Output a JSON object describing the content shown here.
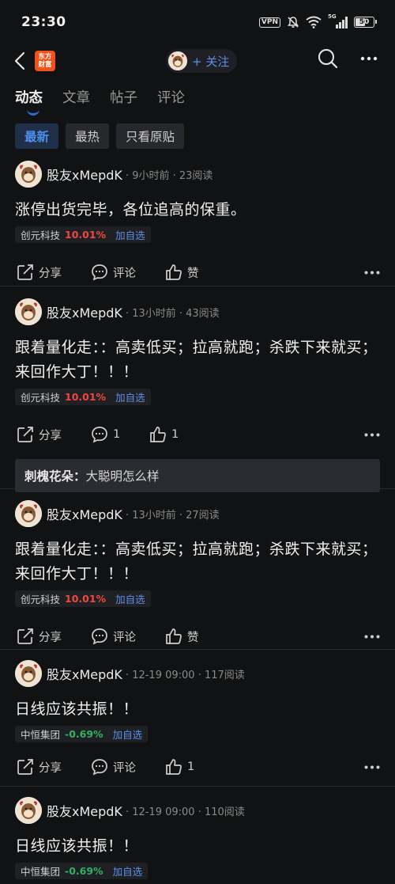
{
  "status": {
    "time": "23:30",
    "vpn": "VPN",
    "network": "5G",
    "battery": "50"
  },
  "header": {
    "logo_line1": "东方",
    "logo_line2": "财富",
    "follow_label": "+ 关注"
  },
  "tabs": [
    {
      "label": "动态",
      "active": true
    },
    {
      "label": "文章",
      "active": false
    },
    {
      "label": "帖子",
      "active": false
    },
    {
      "label": "评论",
      "active": false
    }
  ],
  "filters": [
    {
      "label": "最新",
      "active": true
    },
    {
      "label": "最热",
      "active": false
    },
    {
      "label": "只看原贴",
      "active": false
    }
  ],
  "posts": [
    {
      "user": "股友xMepdK",
      "meta": "· 9小时前 · 23阅读",
      "text": "涨停出货完毕，各位追高的保重。",
      "stock": {
        "name": "创元科技",
        "change": "10.01%",
        "add": "加自选",
        "direction": "up"
      },
      "share": "分享",
      "comment": "评论",
      "like": "赞"
    },
    {
      "user": "股友xMepdK",
      "meta": "· 13小时前 · 43阅读",
      "text": "跟着量化走：：高卖低买；拉高就跑；杀跌下来就买；来回作大丁！！！",
      "stock": {
        "name": "创元科技",
        "change": "10.01%",
        "add": "加自选",
        "direction": "up"
      },
      "share": "分享",
      "comment": "1",
      "like": "1",
      "reply": {
        "user": "刺槐花朵：",
        "text": "大聪明怎么样"
      }
    },
    {
      "user": "股友xMepdK",
      "meta": "· 13小时前 · 27阅读",
      "text": "跟着量化走：：高卖低买；拉高就跑；杀跌下来就买；来回作大丁！！！",
      "stock": {
        "name": "创元科技",
        "change": "10.01%",
        "add": "加自选",
        "direction": "up"
      },
      "share": "分享",
      "comment": "评论",
      "like": "赞"
    },
    {
      "user": "股友xMepdK",
      "meta": "· 12-19 09:00 · 117阅读",
      "text": "日线应该共振！！",
      "stock": {
        "name": "中恒集团",
        "change": "-0.69%",
        "add": "加自选",
        "direction": "down"
      },
      "share": "分享",
      "comment": "评论",
      "like": "1"
    },
    {
      "user": "股友xMepdK",
      "meta": "· 12-19 09:00 · 110阅读",
      "text": "日线应该共振！！",
      "stock": {
        "name": "中恒集团",
        "change": "-0.69%",
        "add": "加自选",
        "direction": "down"
      }
    }
  ],
  "colors": {
    "background": "#111213",
    "accent_blue": "#4f8ef0",
    "up_red": "#f0483e",
    "down_green": "#2fb35e",
    "brand_orange": "#f0521a"
  }
}
